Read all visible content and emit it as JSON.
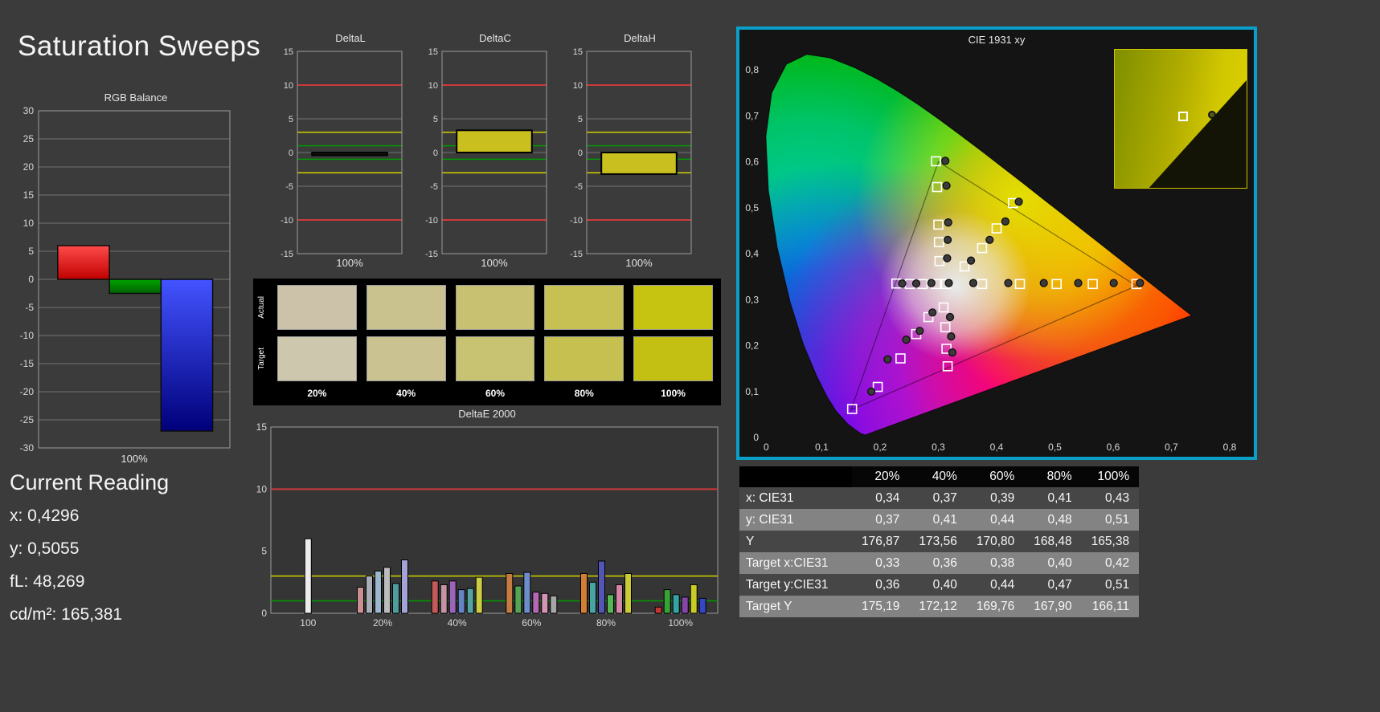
{
  "page": {
    "title": "Saturation Sweeps",
    "background": "#3b3b3b",
    "accent_border": "#0a9fc9"
  },
  "current_reading": {
    "title": "Current Reading",
    "lines": [
      "x: 0,4296",
      "y: 0,5055",
      "fL: 48,269",
      "cd/m²: 165,381"
    ]
  },
  "swatches": {
    "row_labels": [
      "Actual",
      "Target"
    ],
    "col_labels": [
      "20%",
      "40%",
      "60%",
      "80%",
      "100%"
    ],
    "actual_colors": [
      "#cbc2a9",
      "#c9c28e",
      "#c7c171",
      "#c6c152",
      "#c6c410"
    ],
    "target_colors": [
      "#cdc7ad",
      "#cac391",
      "#c8c373",
      "#c5c050",
      "#c4c013"
    ]
  },
  "table": {
    "headers": [
      "20%",
      "40%",
      "60%",
      "80%",
      "100%"
    ],
    "rows": [
      {
        "label": "x: CIE31",
        "values": [
          "0,34",
          "0,37",
          "0,39",
          "0,41",
          "0,43"
        ]
      },
      {
        "label": "y: CIE31",
        "values": [
          "0,37",
          "0,41",
          "0,44",
          "0,48",
          "0,51"
        ]
      },
      {
        "label": "Y",
        "values": [
          "176,87",
          "173,56",
          "170,80",
          "168,48",
          "165,38"
        ]
      },
      {
        "label": "Target x:CIE31",
        "values": [
          "0,33",
          "0,36",
          "0,38",
          "0,40",
          "0,42"
        ]
      },
      {
        "label": "Target y:CIE31",
        "values": [
          "0,36",
          "0,40",
          "0,44",
          "0,47",
          "0,51"
        ]
      },
      {
        "label": "Target Y",
        "values": [
          "175,19",
          "172,12",
          "169,76",
          "167,90",
          "166,11"
        ]
      }
    ]
  },
  "chart_data": [
    {
      "id": "rgb_balance",
      "type": "bar",
      "title": "RGB Balance",
      "categories": [
        "Red",
        "Green",
        "Blue"
      ],
      "values": [
        6,
        -2.5,
        -27
      ],
      "colors": [
        "#e01616",
        "#009c00",
        "#1e28d2"
      ],
      "ylim": [
        -30,
        30
      ],
      "ytick_step": 5,
      "xlabel": "100%"
    },
    {
      "id": "delta_l",
      "type": "bar",
      "title": "DeltaL",
      "categories": [
        "100%"
      ],
      "values": [
        -0.4
      ],
      "bar_color": "#161616",
      "ylim": [
        -15,
        15
      ],
      "ytick_step": 5,
      "xlabel": "100%",
      "ref_lines": [
        {
          "v": 10,
          "color": "#cc3a3a"
        },
        {
          "v": 3,
          "color": "#d2d200"
        },
        {
          "v": 1,
          "color": "#009a00"
        },
        {
          "v": -1,
          "color": "#009a00"
        },
        {
          "v": -3,
          "color": "#d2d200"
        },
        {
          "v": -10,
          "color": "#cc3a3a"
        }
      ]
    },
    {
      "id": "delta_c",
      "type": "bar",
      "title": "DeltaC",
      "categories": [
        "100%"
      ],
      "values": [
        3.3
      ],
      "bar_color": "#c9bf1e",
      "ylim": [
        -15,
        15
      ],
      "ytick_step": 5,
      "xlabel": "100%",
      "ref_lines": [
        {
          "v": 10,
          "color": "#cc3a3a"
        },
        {
          "v": 3,
          "color": "#d2d200"
        },
        {
          "v": 1,
          "color": "#009a00"
        },
        {
          "v": -1,
          "color": "#009a00"
        },
        {
          "v": -3,
          "color": "#d2d200"
        },
        {
          "v": -10,
          "color": "#cc3a3a"
        }
      ]
    },
    {
      "id": "delta_h",
      "type": "bar",
      "title": "DeltaH",
      "categories": [
        "100%"
      ],
      "values": [
        -3.2
      ],
      "bar_color": "#c9bf1e",
      "ylim": [
        -15,
        15
      ],
      "ytick_step": 5,
      "xlabel": "100%",
      "ref_lines": [
        {
          "v": 10,
          "color": "#cc3a3a"
        },
        {
          "v": 3,
          "color": "#d2d200"
        },
        {
          "v": 1,
          "color": "#009a00"
        },
        {
          "v": -1,
          "color": "#009a00"
        },
        {
          "v": -3,
          "color": "#d2d200"
        },
        {
          "v": -10,
          "color": "#cc3a3a"
        }
      ]
    },
    {
      "id": "deltae2000",
      "type": "bar",
      "title": "DeltaE 2000",
      "ylim": [
        0,
        15
      ],
      "yticks": [
        0,
        5,
        10,
        15
      ],
      "ref_lines": [
        {
          "v": 10,
          "color": "#cc3a3a"
        },
        {
          "v": 3,
          "color": "#d2d200"
        },
        {
          "v": 1,
          "color": "#009a00"
        }
      ],
      "groups": [
        {
          "label": "100",
          "bars": [
            {
              "v": 6.0,
              "c": "#ececec"
            }
          ]
        },
        {
          "label": "20%",
          "bars": [
            {
              "v": 2.1,
              "c": "#c98f92"
            },
            {
              "v": 3.0,
              "c": "#a9adb5"
            },
            {
              "v": 3.4,
              "c": "#9db6cf"
            },
            {
              "v": 3.7,
              "c": "#bcbcbc"
            },
            {
              "v": 2.4,
              "c": "#4f9d9d"
            },
            {
              "v": 4.3,
              "c": "#a3a3d6"
            }
          ]
        },
        {
          "label": "40%",
          "bars": [
            {
              "v": 2.6,
              "c": "#c25a5a"
            },
            {
              "v": 2.3,
              "c": "#c493a4"
            },
            {
              "v": 2.6,
              "c": "#9a64b8"
            },
            {
              "v": 1.9,
              "c": "#6484c4"
            },
            {
              "v": 2.0,
              "c": "#54a3a3"
            },
            {
              "v": 2.9,
              "c": "#cbcb46"
            }
          ]
        },
        {
          "label": "60%",
          "bars": [
            {
              "v": 3.2,
              "c": "#c47c42"
            },
            {
              "v": 2.2,
              "c": "#55a455"
            },
            {
              "v": 3.3,
              "c": "#6c8cca"
            },
            {
              "v": 1.7,
              "c": "#b468b4"
            },
            {
              "v": 1.6,
              "c": "#d494b4"
            },
            {
              "v": 1.4,
              "c": "#a6a6a6"
            }
          ]
        },
        {
          "label": "80%",
          "bars": [
            {
              "v": 3.2,
              "c": "#d47e35"
            },
            {
              "v": 2.5,
              "c": "#46a4a4"
            },
            {
              "v": 4.2,
              "c": "#5456b6"
            },
            {
              "v": 1.5,
              "c": "#56b656"
            },
            {
              "v": 2.3,
              "c": "#d486a6"
            },
            {
              "v": 3.2,
              "c": "#cbcb35"
            }
          ]
        },
        {
          "label": "100%",
          "bars": [
            {
              "v": 0.5,
              "c": "#c43535"
            },
            {
              "v": 1.9,
              "c": "#35a435"
            },
            {
              "v": 1.5,
              "c": "#35a4a4"
            },
            {
              "v": 1.3,
              "c": "#8646a6"
            },
            {
              "v": 2.3,
              "c": "#cbcb26"
            },
            {
              "v": 1.2,
              "c": "#3546c4"
            }
          ]
        }
      ]
    },
    {
      "id": "cie",
      "type": "scatter",
      "title": "CIE 1931 xy",
      "xlim": [
        0,
        0.8
      ],
      "ylim": [
        0,
        0.8
      ],
      "xticks": [
        "0",
        "0,1",
        "0,2",
        "0,3",
        "0,4",
        "0,5",
        "0,6",
        "0,7",
        "0,8"
      ],
      "yticks": [
        "0",
        "0,1",
        "0,2",
        "0,3",
        "0,4",
        "0,5",
        "0,6",
        "0,7",
        "0,8"
      ],
      "triangle": [
        [
          0.64,
          0.33
        ],
        [
          0.3,
          0.6
        ],
        [
          0.15,
          0.06
        ]
      ],
      "targets": [
        [
          0.313,
          0.334
        ],
        [
          0.296,
          0.334
        ],
        [
          0.273,
          0.334
        ],
        [
          0.251,
          0.334
        ],
        [
          0.228,
          0.335
        ],
        [
          0.375,
          0.334
        ],
        [
          0.44,
          0.334
        ],
        [
          0.503,
          0.334
        ],
        [
          0.565,
          0.334
        ],
        [
          0.64,
          0.334
        ],
        [
          0.302,
          0.384
        ],
        [
          0.301,
          0.425
        ],
        [
          0.3,
          0.463
        ],
        [
          0.298,
          0.545
        ],
        [
          0.296,
          0.601
        ],
        [
          0.345,
          0.372
        ],
        [
          0.375,
          0.412
        ],
        [
          0.4,
          0.455
        ],
        [
          0.428,
          0.51
        ],
        [
          0.309,
          0.283
        ],
        [
          0.312,
          0.24
        ],
        [
          0.314,
          0.193
        ],
        [
          0.316,
          0.155
        ],
        [
          0.283,
          0.262
        ],
        [
          0.262,
          0.225
        ],
        [
          0.235,
          0.172
        ],
        [
          0.196,
          0.11
        ],
        [
          0.152,
          0.062
        ]
      ],
      "measurements": [
        [
          0.318,
          0.336
        ],
        [
          0.288,
          0.336
        ],
        [
          0.262,
          0.335
        ],
        [
          0.238,
          0.335
        ],
        [
          0.36,
          0.336
        ],
        [
          0.42,
          0.336
        ],
        [
          0.481,
          0.336
        ],
        [
          0.54,
          0.336
        ],
        [
          0.601,
          0.336
        ],
        [
          0.646,
          0.336
        ],
        [
          0.315,
          0.39
        ],
        [
          0.316,
          0.43
        ],
        [
          0.317,
          0.468
        ],
        [
          0.314,
          0.548
        ],
        [
          0.312,
          0.602
        ],
        [
          0.356,
          0.385
        ],
        [
          0.388,
          0.43
        ],
        [
          0.415,
          0.47
        ],
        [
          0.438,
          0.513
        ],
        [
          0.32,
          0.262
        ],
        [
          0.322,
          0.22
        ],
        [
          0.324,
          0.185
        ],
        [
          0.29,
          0.272
        ],
        [
          0.268,
          0.232
        ],
        [
          0.245,
          0.213
        ],
        [
          0.213,
          0.17
        ],
        [
          0.185,
          0.1
        ]
      ]
    }
  ]
}
